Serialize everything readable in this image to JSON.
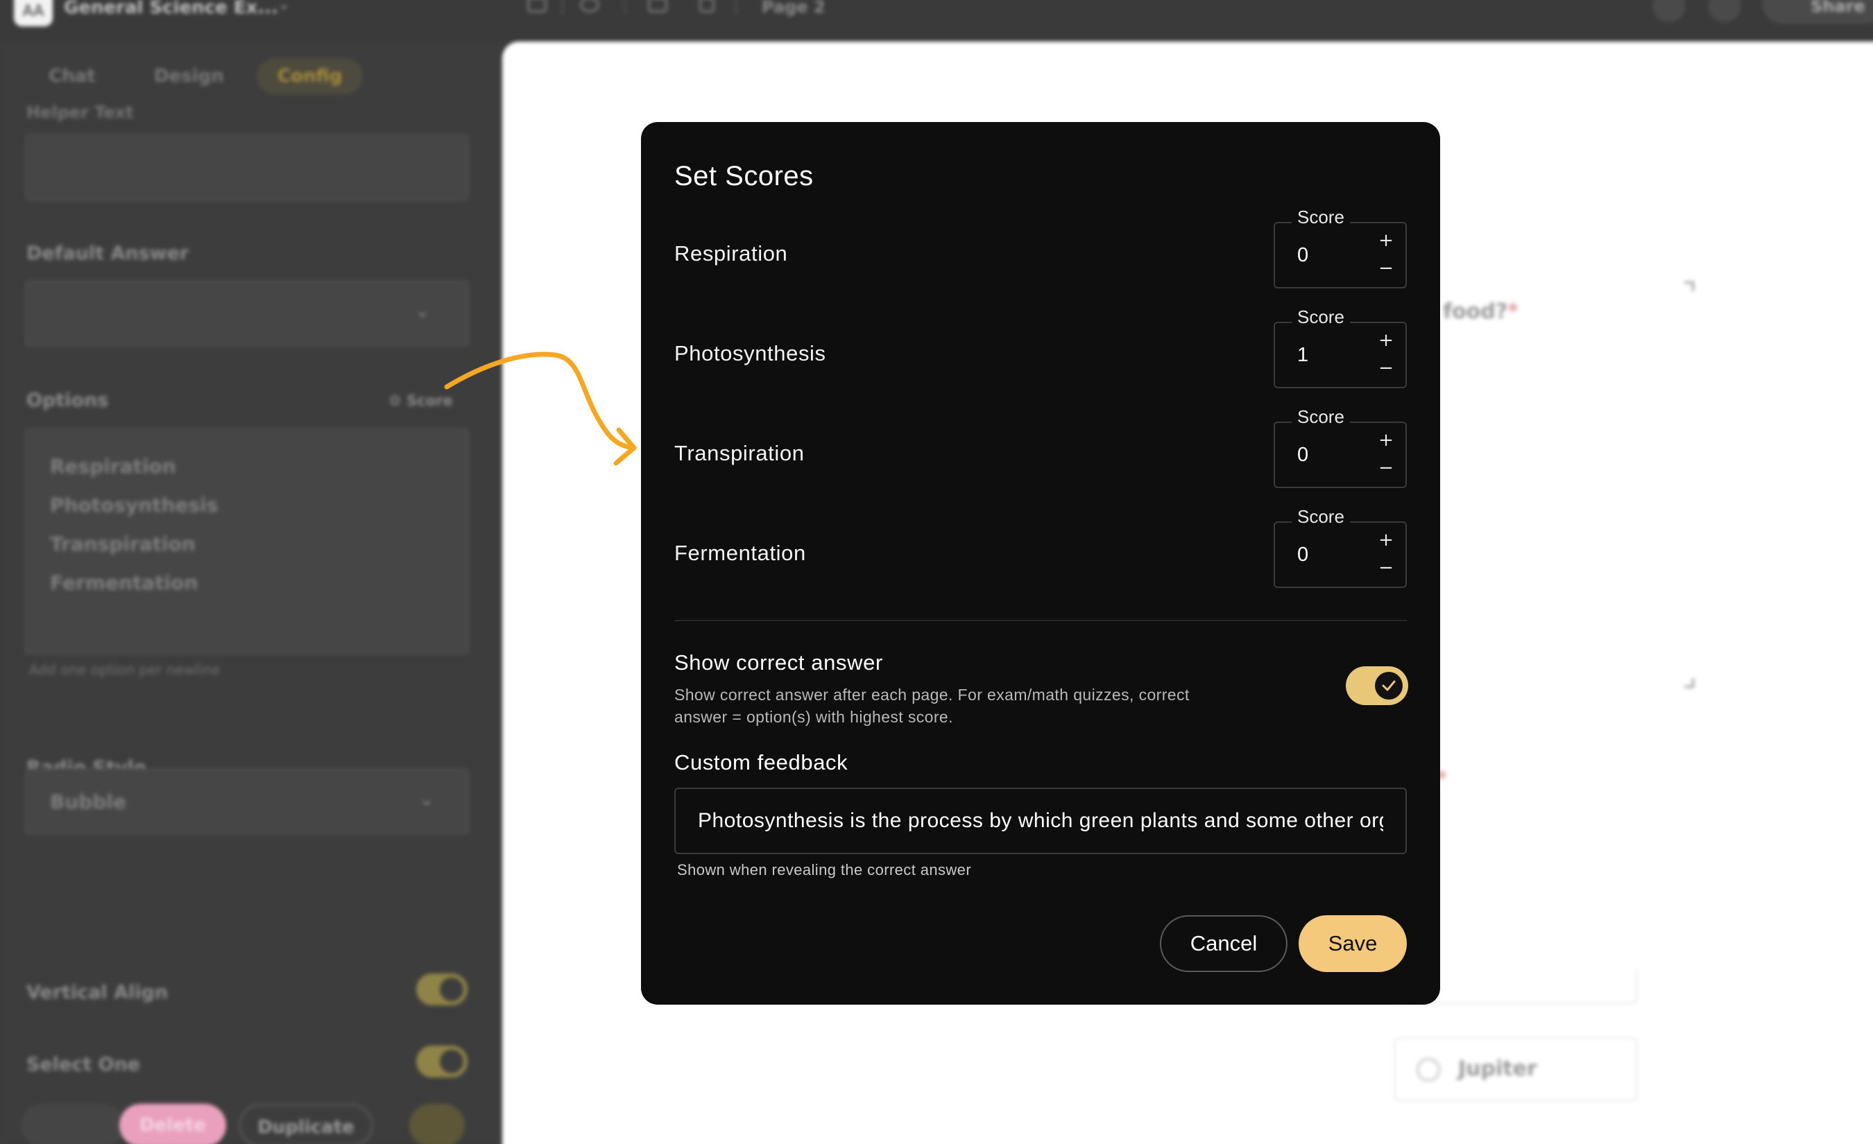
{
  "topbar": {
    "logo_text": "AA",
    "project_name": "General Science Ex...",
    "page_label": "Page 2",
    "share_label": "Share"
  },
  "left_panel": {
    "tabs": [
      {
        "label": "Chat"
      },
      {
        "label": "Design"
      },
      {
        "label": "Config"
      }
    ],
    "active_tab": "Config",
    "helper_text_label": "Helper Text",
    "default_answer_label": "Default Answer",
    "options_label": "Options",
    "score_link": "Score",
    "options": [
      "Respiration",
      "Photosynthesis",
      "Transpiration",
      "Fermentation"
    ],
    "options_help": "Add one option per newline",
    "radio_style_label": "Radio Style",
    "radio_style_value": "Bubble",
    "vertical_align_label": "Vertical Align",
    "select_one_label": "Select One",
    "delete_label": "Delete",
    "duplicate_label": "Duplicate"
  },
  "canvas": {
    "question_fragment": "food?",
    "required_mark": "*",
    "option_card_label": "Jupiter"
  },
  "modal": {
    "title": "Set Scores",
    "score_field_label": "Score",
    "rows": [
      {
        "label": "Respiration",
        "score": "0"
      },
      {
        "label": "Photosynthesis",
        "score": "1"
      },
      {
        "label": "Transpiration",
        "score": "0"
      },
      {
        "label": "Fermentation",
        "score": "0"
      }
    ],
    "show_correct": {
      "title": "Show correct answer",
      "description": "Show correct answer after each page. For exam/math quizzes, correct answer = option(s) with highest score.",
      "enabled": true
    },
    "custom_feedback": {
      "title": "Custom feedback",
      "value": "Photosynthesis is the process by which green plants and some other organisms use sunlight to synthesize foods from carbon dioxide and water.",
      "help": "Shown when revealing the correct answer"
    },
    "cancel_label": "Cancel",
    "save_label": "Save"
  },
  "colors": {
    "accent": "#f4c97c",
    "annotation_arrow": "#f5a623",
    "modal_bg": "#0e0e0f"
  }
}
